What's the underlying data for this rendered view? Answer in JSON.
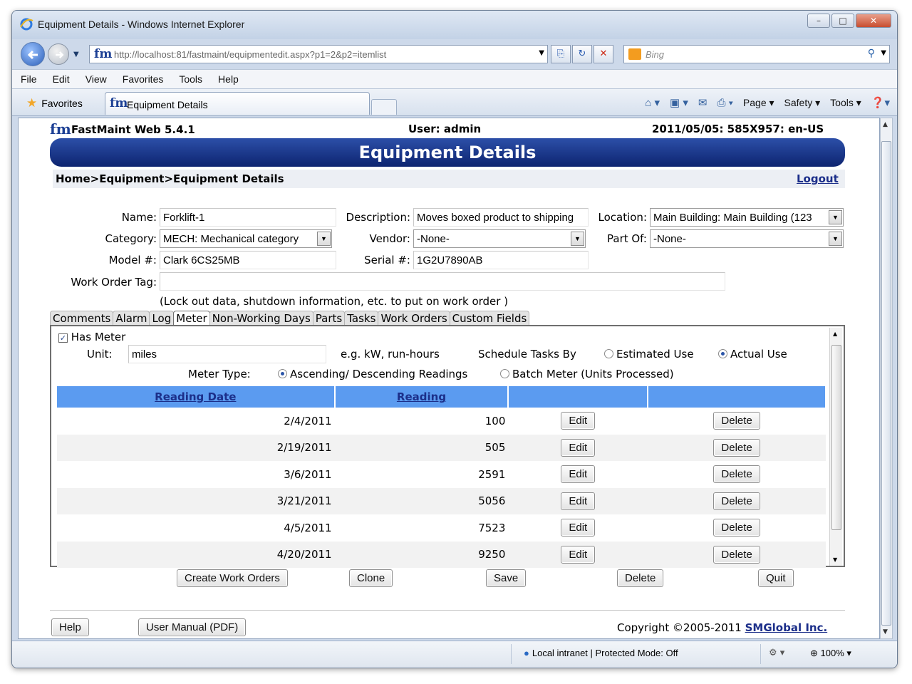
{
  "browser": {
    "window_title": "Equipment Details - Windows Internet Explorer",
    "url": "http://localhost:81/fastmaint/equipmentedit.aspx?p1=2&p2=itemlist",
    "search_placeholder": "Bing",
    "menu": [
      "File",
      "Edit",
      "View",
      "Favorites",
      "Tools",
      "Help"
    ],
    "favorites_label": "Favorites",
    "tab_title": "Equipment Details",
    "commands": [
      "Page",
      "Safety",
      "Tools"
    ],
    "status_zone": "Local intranet | Protected Mode: Off",
    "zoom": "100%"
  },
  "header": {
    "logo": "fm",
    "app_name": "FastMaint Web 5.4.1",
    "user": "User: admin",
    "date_info": "2011/05/05: 585X957: en-US",
    "banner_title": "Equipment Details"
  },
  "breadcrumb": {
    "home": "Home",
    "sep": ">",
    "equipment": "Equipment",
    "current": "Equipment Details",
    "logout": "Logout"
  },
  "form": {
    "name_label": "Name:",
    "name_value": "Forklift-1",
    "description_label": "Description:",
    "description_value": "Moves boxed product to shipping",
    "location_label": "Location:",
    "location_value": "Main Building: Main Building (123",
    "category_label": "Category:",
    "category_value": "MECH: Mechanical category",
    "vendor_label": "Vendor:",
    "vendor_value": "-None-",
    "partof_label": "Part Of:",
    "partof_value": "-None-",
    "model_label": "Model #:",
    "model_value": "Clark 6CS25MB",
    "serial_label": "Serial #:",
    "serial_value": "1G2U7890AB",
    "wo_tag_label": "Work Order Tag:",
    "wo_tag_value": "",
    "wo_tag_hint": "(Lock out data, shutdown information, etc. to put on work order )"
  },
  "tabs": [
    "Comments",
    "Alarm",
    "Log",
    "Meter",
    "Non-Working Days",
    "Parts",
    "Tasks",
    "Work Orders",
    "Custom Fields"
  ],
  "active_tab": "Meter",
  "meter": {
    "has_meter_label": "Has Meter",
    "has_meter_checked": true,
    "unit_label": "Unit:",
    "unit_value": "miles",
    "unit_hint": "e.g. kW, run-hours",
    "schedule_label": "Schedule Tasks By",
    "schedule_options": [
      "Estimated Use",
      "Actual Use"
    ],
    "schedule_selected": "Actual Use",
    "meter_type_label": "Meter Type:",
    "meter_type_options": [
      "Ascending/ Descending Readings",
      "Batch Meter (Units Processed)"
    ],
    "meter_type_selected": "Ascending/ Descending Readings",
    "columns": [
      "Reading Date",
      "Reading"
    ],
    "edit_label": "Edit",
    "delete_label": "Delete",
    "rows": [
      {
        "date": "2/4/2011",
        "reading": "100"
      },
      {
        "date": "2/19/2011",
        "reading": "505"
      },
      {
        "date": "3/6/2011",
        "reading": "2591"
      },
      {
        "date": "3/21/2011",
        "reading": "5056"
      },
      {
        "date": "4/5/2011",
        "reading": "7523"
      },
      {
        "date": "4/20/2011",
        "reading": "9250"
      }
    ]
  },
  "actions": {
    "create_work_orders": "Create Work Orders",
    "clone": "Clone",
    "save": "Save",
    "delete": "Delete",
    "quit": "Quit"
  },
  "footer": {
    "help": "Help",
    "user_manual": "User Manual (PDF)",
    "copyright": "Copyright ©2005-2011",
    "company": "SMGlobal Inc."
  },
  "colors": {
    "banner": "#1c3f94",
    "grid_header": "#5b9bf0",
    "link": "#1c2f8a"
  }
}
